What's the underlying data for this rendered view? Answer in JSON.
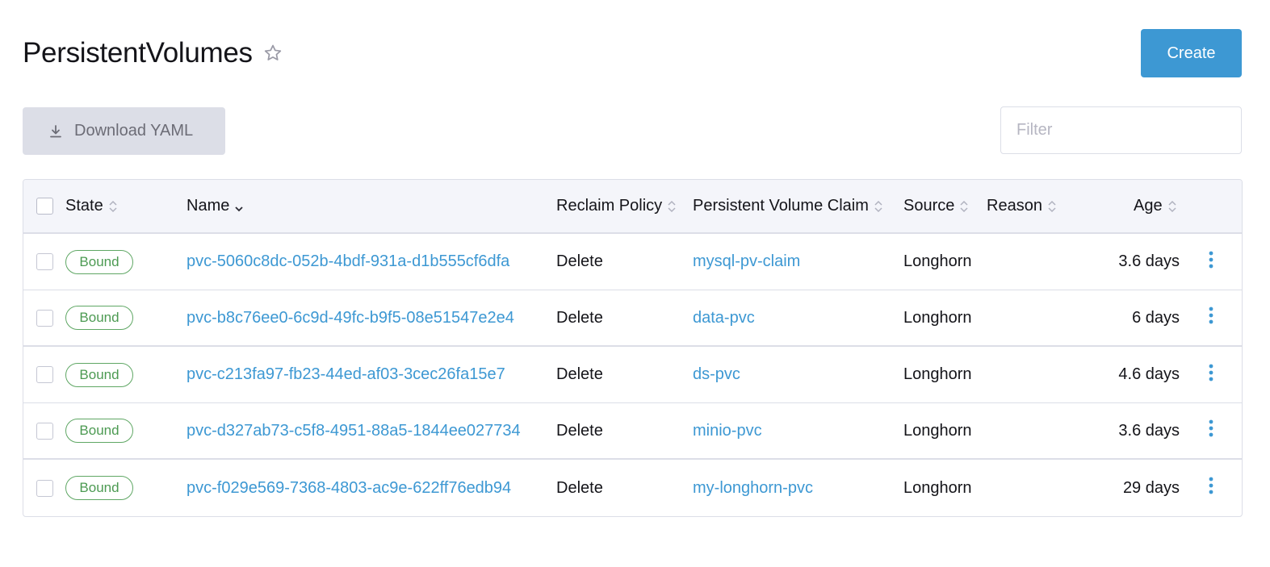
{
  "header": {
    "title": "PersistentVolumes",
    "favorite_icon": "star-outline-icon",
    "create_label": "Create"
  },
  "toolbar": {
    "download_label": "Download YAML",
    "download_icon": "download-icon",
    "filter_placeholder": "Filter",
    "filter_value": ""
  },
  "table": {
    "columns": {
      "state": "State",
      "name": "Name",
      "reclaim_policy": "Reclaim Policy",
      "pvc": "Persistent Volume Claim",
      "source": "Source",
      "reason": "Reason",
      "age": "Age"
    },
    "sorted_by": "Name",
    "rows": [
      {
        "state": "Bound",
        "name": "pvc-5060c8dc-052b-4bdf-931a-d1b555cf6dfa",
        "reclaim_policy": "Delete",
        "pvc": "mysql-pv-claim",
        "source": "Longhorn",
        "reason": "",
        "age": "3.6 days"
      },
      {
        "state": "Bound",
        "name": "pvc-b8c76ee0-6c9d-49fc-b9f5-08e51547e2e4",
        "reclaim_policy": "Delete",
        "pvc": "data-pvc",
        "source": "Longhorn",
        "reason": "",
        "age": "6 days"
      },
      {
        "state": "Bound",
        "name": "pvc-c213fa97-fb23-44ed-af03-3cec26fa15e7",
        "reclaim_policy": "Delete",
        "pvc": "ds-pvc",
        "source": "Longhorn",
        "reason": "",
        "age": "4.6 days"
      },
      {
        "state": "Bound",
        "name": "pvc-d327ab73-c5f8-4951-88a5-1844ee027734",
        "reclaim_policy": "Delete",
        "pvc": "minio-pvc",
        "source": "Longhorn",
        "reason": "",
        "age": "3.6 days"
      },
      {
        "state": "Bound",
        "name": "pvc-f029e569-7368-4803-ac9e-622ff76edb94",
        "reclaim_policy": "Delete",
        "pvc": "my-longhorn-pvc",
        "source": "Longhorn",
        "reason": "",
        "age": "29 days"
      }
    ]
  },
  "colors": {
    "accent": "#3d98d3",
    "badge_green": "#4c9a52",
    "header_bg": "#f4f5fa",
    "border": "#dcdee7"
  }
}
